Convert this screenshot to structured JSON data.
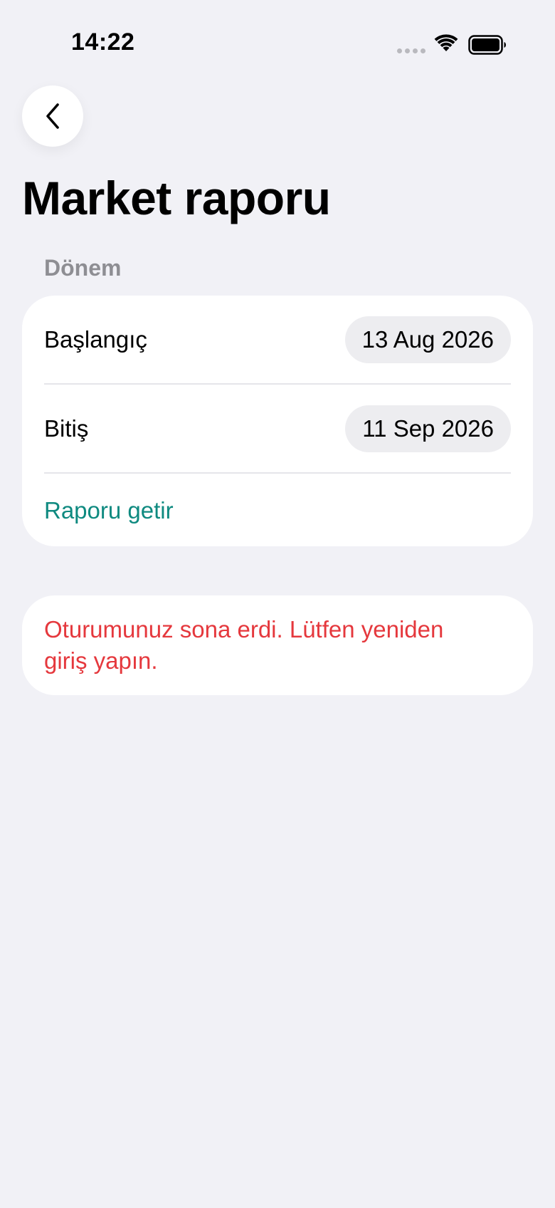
{
  "status_bar": {
    "time": "14:22",
    "wifi_icon": "wifi-icon",
    "battery_icon": "battery-icon"
  },
  "navigation": {
    "back_icon": "chevron-left-icon"
  },
  "page": {
    "title": "Market raporu"
  },
  "period": {
    "section_label": "Dönem",
    "start_label": "Başlangıç",
    "start_value": "13 Aug 2026",
    "end_label": "Bitiş",
    "end_value": "11 Sep 2026",
    "fetch_label": "Raporu getir"
  },
  "error": {
    "message": "Oturumunuz sona erdi. Lütfen yeniden giriş yapın."
  },
  "colors": {
    "background": "#f1f1f6",
    "accent": "#0f8a80",
    "error": "#e5383d",
    "secondary_text": "#8e8e93"
  }
}
